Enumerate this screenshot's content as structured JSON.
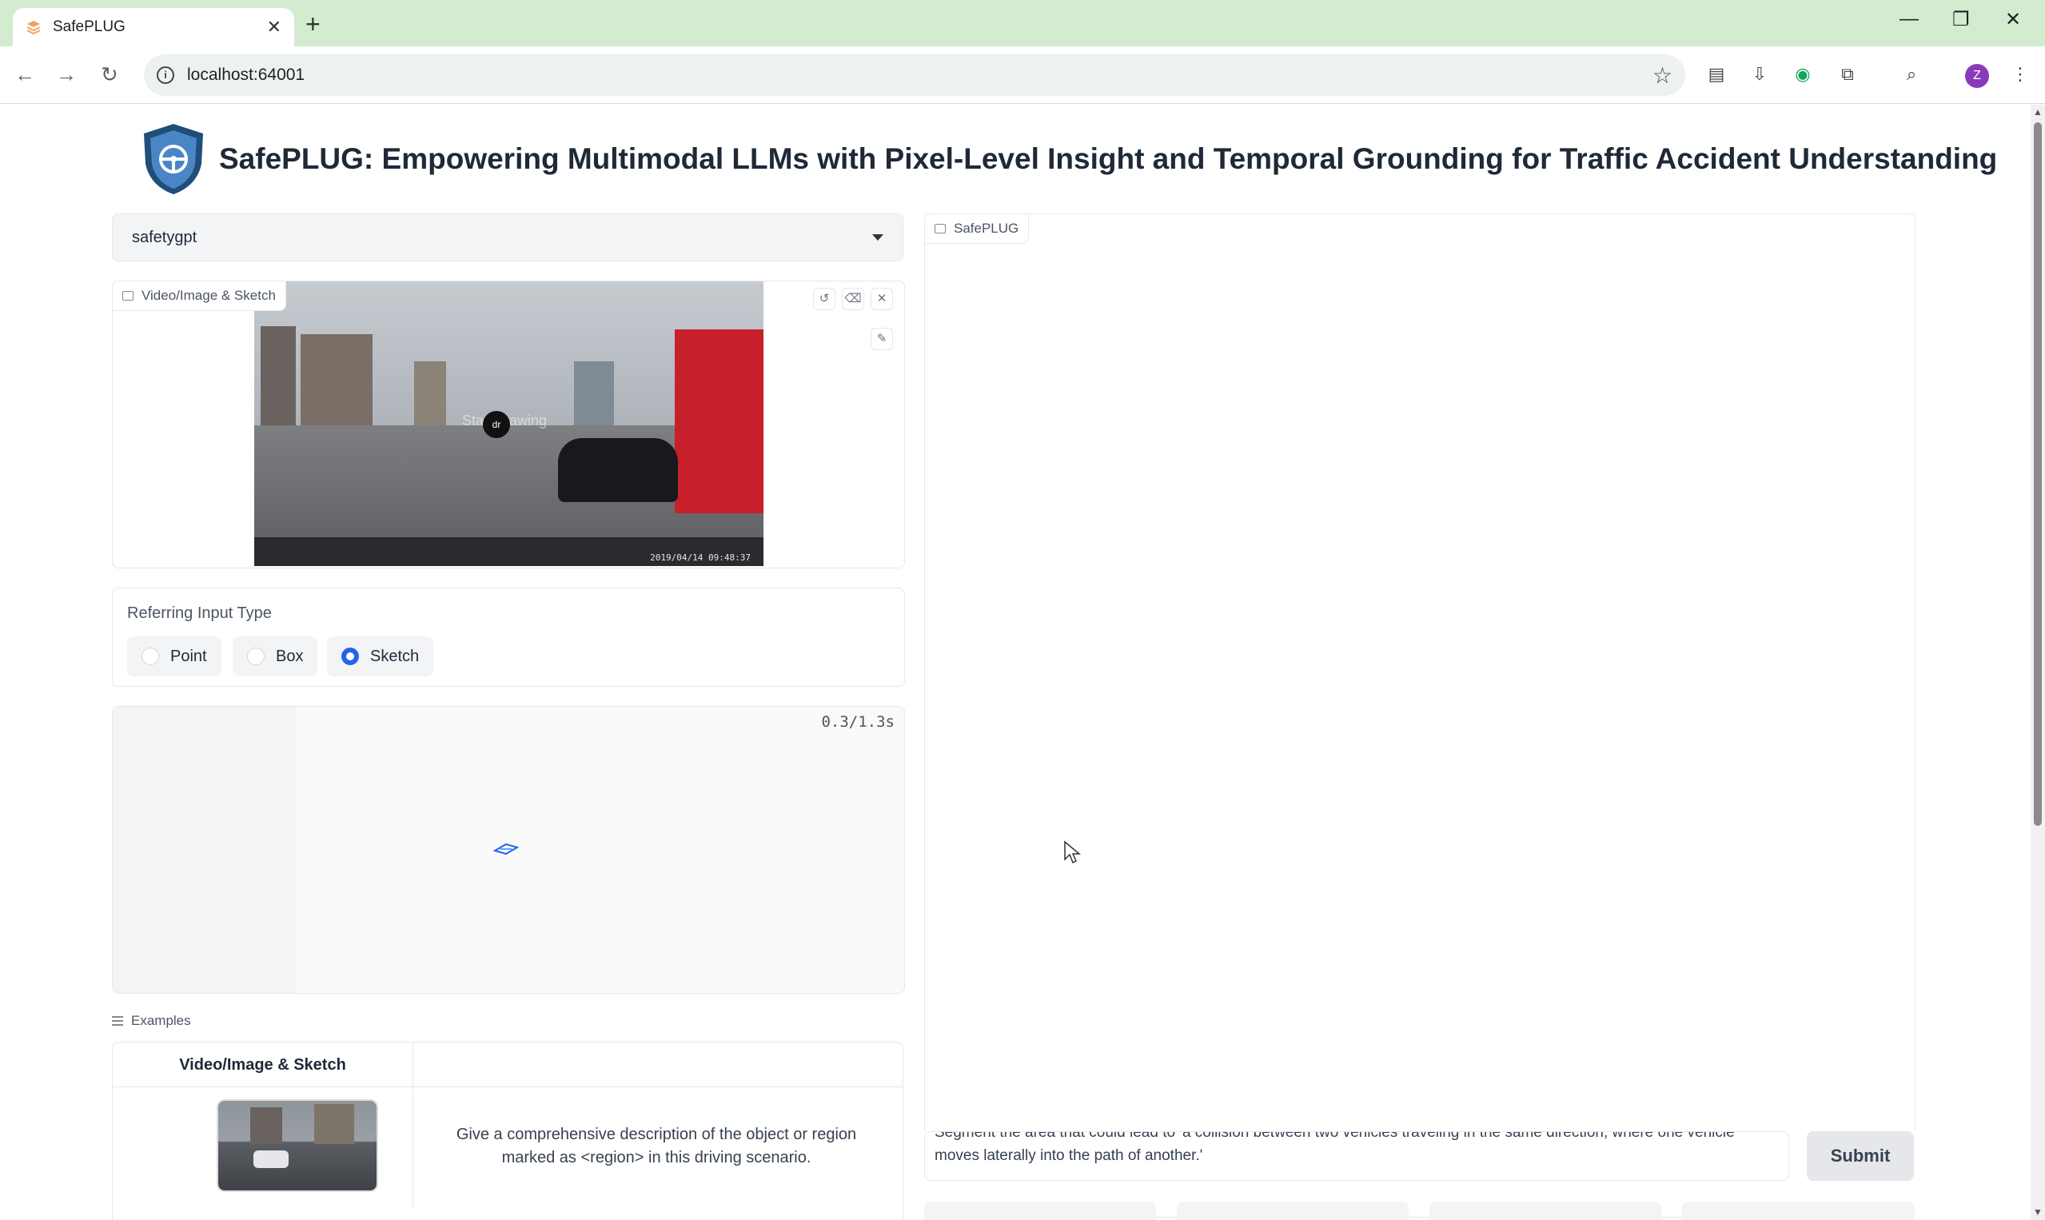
{
  "browser": {
    "tab_title": "SafePLUG",
    "url": "localhost:64001",
    "profile_initial": "Z"
  },
  "app": {
    "title": "SafePLUG: Empowering Multimodal LLMs with Pixel-Level Insight and Temporal Grounding for Traffic Accident Understanding",
    "model_selected": "safetygpt",
    "image_panel_label": "Video/Image & Sketch",
    "image_overlay_text": "Start drawing",
    "image_timestamp": "2019/04/14 09:48:37",
    "referring": {
      "label": "Referring Input Type",
      "options": [
        "Point",
        "Box",
        "Sketch"
      ],
      "selected": "Sketch"
    },
    "video_timer": "0.3/1.3s",
    "examples": {
      "label": "Examples",
      "column_header": "Video/Image & Sketch",
      "rows": [
        {
          "text": "Give a comprehensive description of the object or region marked as <region> in this driving scenario."
        }
      ]
    },
    "chat": {
      "label": "SafePLUG",
      "input_text": "Segment the area that could lead to 'a collision between two vehicles traveling in the same direction, where one vehicle moves laterally into the path of another.'",
      "submit_label": "Submit"
    }
  },
  "colors": {
    "accent": "#2563eb",
    "tabstrip": "#d3ecd0",
    "truck": "#c8202a"
  }
}
